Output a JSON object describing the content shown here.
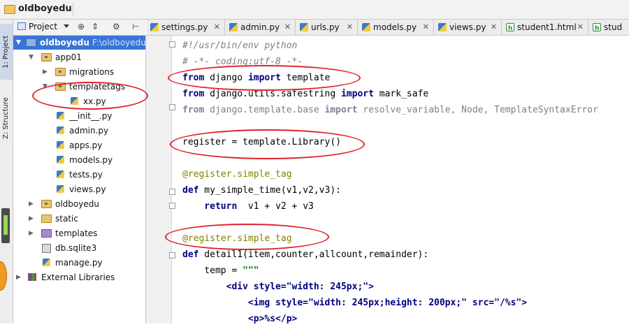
{
  "window": {
    "title": "oldboyedu"
  },
  "side_tabs": {
    "project": "1: Project",
    "structure": "Z: Structure"
  },
  "project_toolbar": {
    "label": "Project",
    "icons": [
      "target-icon",
      "collapse-icon",
      "gear-icon",
      "hide-icon"
    ]
  },
  "tree": {
    "root_name": "oldboyedu",
    "root_path": "F:\\oldboyedu",
    "items": [
      {
        "label": "app01"
      },
      {
        "label": "migrations"
      },
      {
        "label": "templatetags"
      },
      {
        "label": "xx.py"
      },
      {
        "label": "__init__.py"
      },
      {
        "label": "admin.py"
      },
      {
        "label": "apps.py"
      },
      {
        "label": "models.py"
      },
      {
        "label": "tests.py"
      },
      {
        "label": "views.py"
      },
      {
        "label": "oldboyedu"
      },
      {
        "label": "static"
      },
      {
        "label": "templates"
      },
      {
        "label": "db.sqlite3"
      },
      {
        "label": "manage.py"
      },
      {
        "label": "External Libraries"
      }
    ]
  },
  "tabs": [
    {
      "label": "settings.py"
    },
    {
      "label": "admin.py"
    },
    {
      "label": "urls.py"
    },
    {
      "label": "models.py"
    },
    {
      "label": "views.py"
    },
    {
      "label": "student1.html"
    },
    {
      "label": "stud"
    }
  ],
  "code": {
    "l1": "#!/usr/bin/env python",
    "l2": "# -*- coding:utf-8 -*-",
    "l3a": "from",
    "l3b": " django ",
    "l3c": "import",
    "l3d": " template",
    "l4a": "from",
    "l4b": " django.utils.safestring ",
    "l4c": "import",
    "l4d": " mark_safe",
    "l5a": "from",
    "l5b": " django.template.base ",
    "l5c": "import",
    "l5d": " resolve_variable, Node, TemplateSyntaxError",
    "l7": "register = template.Library()",
    "l9": "@register.simple_tag",
    "l10a": "def",
    "l10b": " my_simple_time(v1,v2,v3):",
    "l11a": "    return",
    "l11b": "  v1 + v2 + v3",
    "l13": "@register.simple_tag",
    "l14a": "def",
    "l14b": " detail1(item,counter,allcount,remainder):",
    "l15a": "    temp = ",
    "l15b": "\"\"\"",
    "l16": "        <div style=\"width: 245px;\">",
    "l17": "            <img style=\"width: 245px;height: 200px;\" src=\"/%s\">",
    "l18": "            <p>%s</p>"
  }
}
